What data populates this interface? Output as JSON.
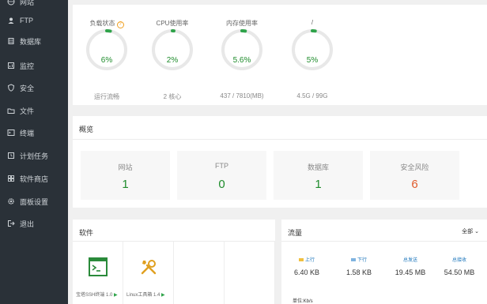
{
  "sidebar": {
    "items": [
      {
        "label": "网站",
        "icon": "globe-icon"
      },
      {
        "label": "FTP",
        "icon": "user-icon"
      },
      {
        "label": "数据库",
        "icon": "database-icon"
      },
      {
        "label": "监控",
        "icon": "monitor-icon"
      },
      {
        "label": "安全",
        "icon": "shield-icon"
      },
      {
        "label": "文件",
        "icon": "folder-icon"
      },
      {
        "label": "终端",
        "icon": "terminal-icon"
      },
      {
        "label": "计划任务",
        "icon": "clock-icon"
      },
      {
        "label": "软件商店",
        "icon": "store-icon"
      },
      {
        "label": "面板设置",
        "icon": "gear-icon"
      },
      {
        "label": "退出",
        "icon": "logout-icon"
      }
    ]
  },
  "status": {
    "gauges": [
      {
        "label": "负载状态",
        "value": "6%",
        "percent": 6,
        "sub": "运行流畅",
        "has_help": true
      },
      {
        "label": "CPU使用率",
        "value": "2%",
        "percent": 2,
        "sub": "2 核心",
        "has_help": false
      },
      {
        "label": "内存使用率",
        "value": "5.6%",
        "percent": 5.6,
        "sub": "437 / 7810(MB)",
        "has_help": false
      },
      {
        "label": "/",
        "value": "5%",
        "percent": 5,
        "sub": "4.5G / 99G",
        "has_help": false
      }
    ],
    "help_glyph": "?"
  },
  "overview": {
    "title": "概览",
    "cards": [
      {
        "label": "网站",
        "value": "1"
      },
      {
        "label": "FTP",
        "value": "0"
      },
      {
        "label": "数据库",
        "value": "1"
      },
      {
        "label": "安全风险",
        "value": "6"
      }
    ]
  },
  "software": {
    "title": "软件",
    "items": [
      {
        "name": "宝塔SSH终端 1.0",
        "icon": "terminal-app-icon"
      },
      {
        "name": "Linux工具箱 1.4",
        "icon": "tools-icon"
      }
    ],
    "play_glyph": "▶"
  },
  "flow": {
    "title": "流量",
    "select_label": "全部",
    "stats": [
      {
        "label": "上行",
        "value": "6.40 KB",
        "color": "#f0c040"
      },
      {
        "label": "下行",
        "value": "1.58 KB",
        "color": "#7fb3e0"
      },
      {
        "label": "总发送",
        "value": "19.45 MB",
        "color": ""
      },
      {
        "label": "总接收",
        "value": "54.50 MB",
        "color": ""
      }
    ],
    "unit_label": "单位:Kb/s"
  },
  "colors": {
    "accent": "#1f8c2c",
    "danger": "#e05a2a",
    "sidebar_bg": "#2a3138"
  }
}
